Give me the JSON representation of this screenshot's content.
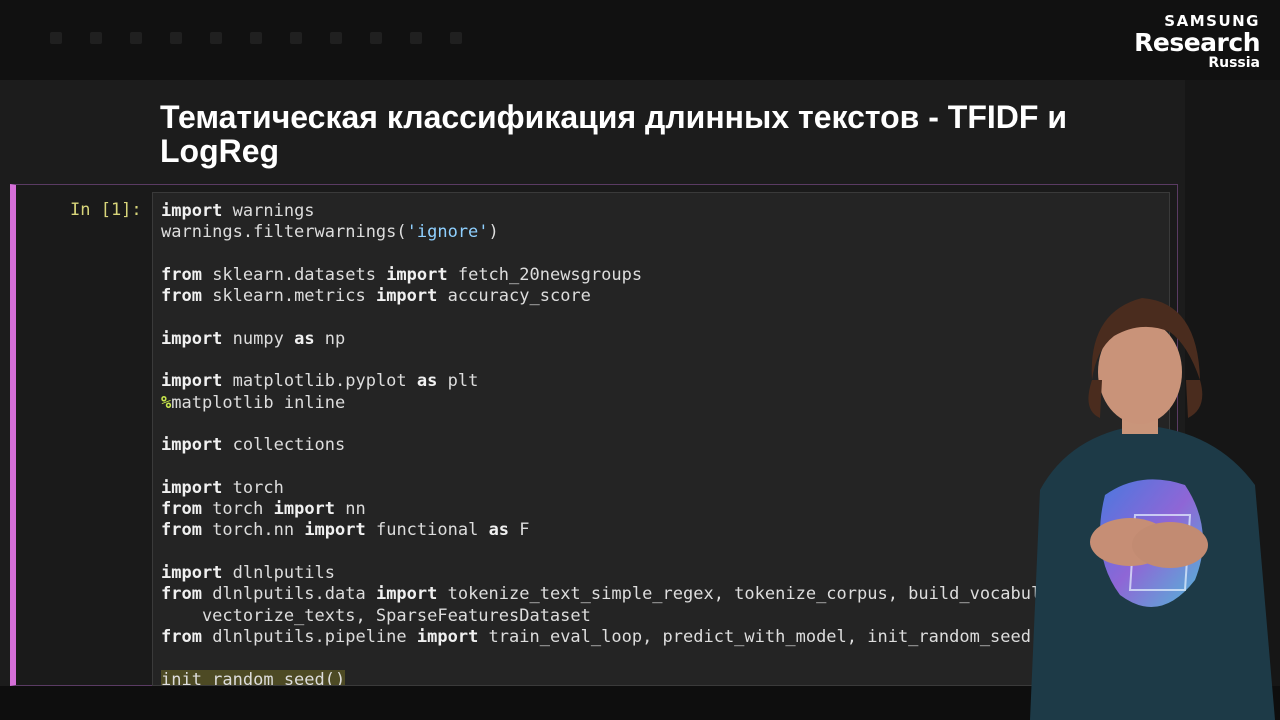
{
  "logo": {
    "brand": "SAMSUNG",
    "main": "Research",
    "sub": "Russia"
  },
  "notebook": {
    "title": "Тематическая классификация длинных текстов - TFIDF и LogReg",
    "cell": {
      "prompt": "In [1]:",
      "lines": [
        [
          {
            "t": "import",
            "k": "kw"
          },
          {
            "t": " warnings"
          }
        ],
        [
          {
            "t": "warnings.filterwarnings("
          },
          {
            "t": "'ignore'",
            "k": "str"
          },
          {
            "t": ")"
          }
        ],
        [],
        [
          {
            "t": "from",
            "k": "kw"
          },
          {
            "t": " sklearn.datasets "
          },
          {
            "t": "import",
            "k": "kw"
          },
          {
            "t": " fetch_20newsgroups"
          }
        ],
        [
          {
            "t": "from",
            "k": "kw"
          },
          {
            "t": " sklearn.metrics "
          },
          {
            "t": "import",
            "k": "kw"
          },
          {
            "t": " accuracy_score"
          }
        ],
        [],
        [
          {
            "t": "import",
            "k": "kw"
          },
          {
            "t": " numpy "
          },
          {
            "t": "as",
            "k": "kw"
          },
          {
            "t": " np"
          }
        ],
        [],
        [
          {
            "t": "import",
            "k": "kw"
          },
          {
            "t": " matplotlib.pyplot "
          },
          {
            "t": "as",
            "k": "kw"
          },
          {
            "t": " plt"
          }
        ],
        [
          {
            "t": "%",
            "k": "magic"
          },
          {
            "t": "matplotlib inline"
          }
        ],
        [],
        [
          {
            "t": "import",
            "k": "kw"
          },
          {
            "t": " collections"
          }
        ],
        [],
        [
          {
            "t": "import",
            "k": "kw"
          },
          {
            "t": " torch"
          }
        ],
        [
          {
            "t": "from",
            "k": "kw"
          },
          {
            "t": " torch "
          },
          {
            "t": "import",
            "k": "kw"
          },
          {
            "t": " nn"
          }
        ],
        [
          {
            "t": "from",
            "k": "kw"
          },
          {
            "t": " torch.nn "
          },
          {
            "t": "import",
            "k": "kw"
          },
          {
            "t": " functional "
          },
          {
            "t": "as",
            "k": "kw"
          },
          {
            "t": " F"
          }
        ],
        [],
        [
          {
            "t": "import",
            "k": "kw"
          },
          {
            "t": " dlnlputils"
          }
        ],
        [
          {
            "t": "from",
            "k": "kw"
          },
          {
            "t": " dlnlputils.data "
          },
          {
            "t": "import",
            "k": "kw"
          },
          {
            "t": " tokenize_text_simple_regex, tokenize_corpus, build_vocabulary, \\"
          }
        ],
        [
          {
            "t": "    vectorize_texts, SparseFeaturesDataset"
          }
        ],
        [
          {
            "t": "from",
            "k": "kw"
          },
          {
            "t": " dlnlputils.pipeline "
          },
          {
            "t": "import",
            "k": "kw"
          },
          {
            "t": " train_eval_loop, predict_with_model, init_random_seed"
          }
        ],
        [],
        [
          {
            "t": "init_random_seed()",
            "k": "hl"
          }
        ]
      ]
    }
  },
  "colors": {
    "cell_border": "#d56fd8",
    "prompt": "#d8d57a",
    "string": "#8fd0ff",
    "magic": "#c8e64c"
  }
}
